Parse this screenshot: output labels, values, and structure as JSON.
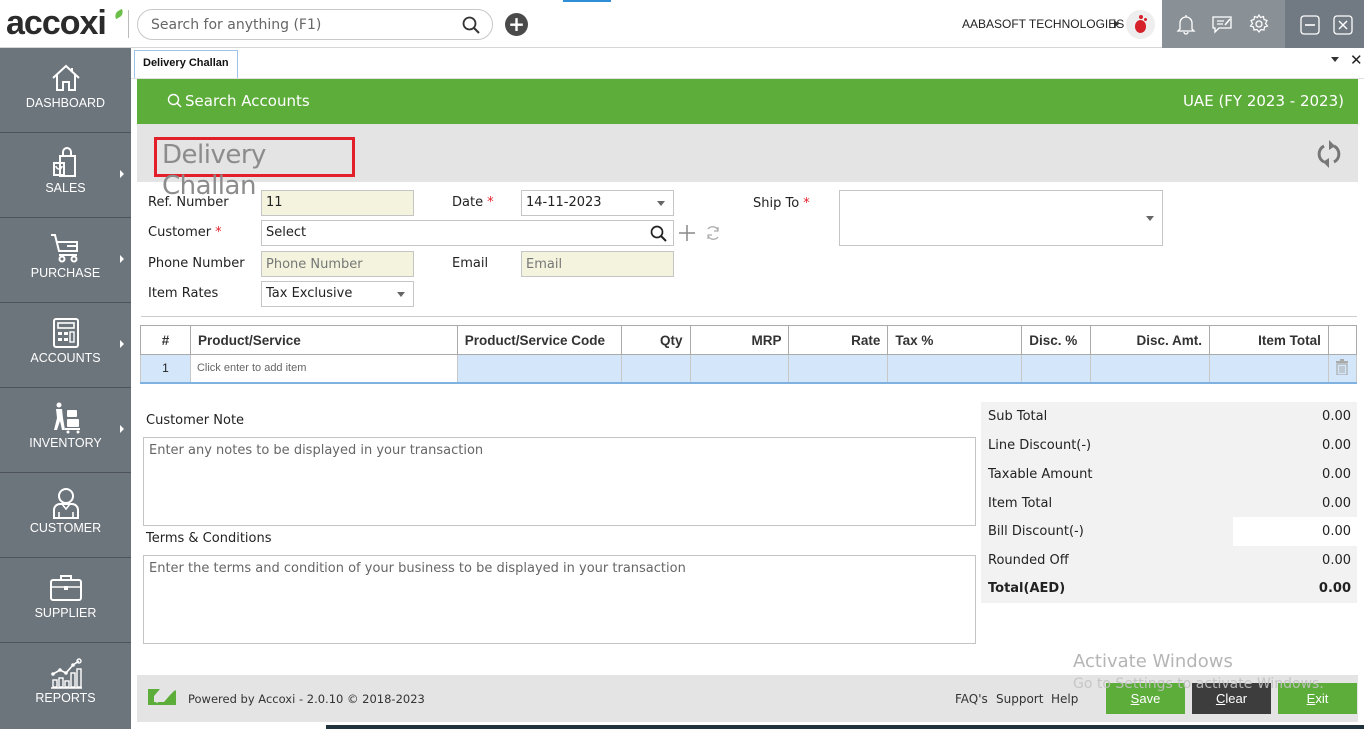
{
  "app": {
    "logo_text": "accoxi",
    "global_search_placeholder": "Search for anything (F1)",
    "company_name": "AABASOFT TECHNOLOGIES",
    "icons": [
      "search-icon",
      "add-icon",
      "bell-icon",
      "message-icon",
      "gear-icon",
      "minimize-icon",
      "close-icon"
    ]
  },
  "sidebar": {
    "items": [
      {
        "label": "DASHBOARD",
        "icon": "home-icon",
        "has_submenu": false
      },
      {
        "label": "SALES",
        "icon": "shopping-bag-icon",
        "has_submenu": true
      },
      {
        "label": "PURCHASE",
        "icon": "cart-icon",
        "has_submenu": true
      },
      {
        "label": "ACCOUNTS",
        "icon": "calculator-icon",
        "has_submenu": true
      },
      {
        "label": "INVENTORY",
        "icon": "trolley-icon",
        "has_submenu": true
      },
      {
        "label": "CUSTOMER",
        "icon": "person-icon",
        "has_submenu": false
      },
      {
        "label": "SUPPLIER",
        "icon": "briefcase-icon",
        "has_submenu": false
      },
      {
        "label": "REPORTS",
        "icon": "chart-icon",
        "has_submenu": false
      }
    ]
  },
  "tabs": [
    {
      "label": "Delivery Challan",
      "active": true
    }
  ],
  "header": {
    "search_accounts": "Search Accounts",
    "region_fy": "UAE (FY 2023 - 2023)",
    "page_title": "Delivery Challan"
  },
  "form": {
    "ref_number": {
      "label": "Ref. Number",
      "value": "11"
    },
    "date": {
      "label": "Date",
      "value": "14-11-2023",
      "required": true
    },
    "ship_to": {
      "label": "Ship To",
      "value": "",
      "required": true
    },
    "customer": {
      "label": "Customer",
      "value": "Select",
      "required": true
    },
    "phone": {
      "label": "Phone Number",
      "placeholder": "Phone Number"
    },
    "email": {
      "label": "Email",
      "placeholder": "Email"
    },
    "item_rates": {
      "label": "Item Rates",
      "value": "Tax Exclusive"
    }
  },
  "items_table": {
    "columns": [
      "#",
      "Product/Service",
      "Product/Service Code",
      "Qty",
      "MRP",
      "Rate",
      "Tax %",
      "Disc. %",
      "Disc. Amt.",
      "Item Total"
    ],
    "rows": [
      {
        "index": "1",
        "product": "Click enter to add item",
        "code": "",
        "qty": "",
        "mrp": "",
        "rate": "",
        "tax": "",
        "disc_pct": "",
        "disc_amt": "",
        "item_total": ""
      }
    ]
  },
  "notes": {
    "customer_note_label": "Customer Note",
    "customer_note_placeholder": "Enter any notes to be displayed in your transaction",
    "terms_label": "Terms & Conditions",
    "terms_placeholder": "Enter the terms and condition of your business to be displayed in your transaction"
  },
  "totals": [
    {
      "label": "Sub Total",
      "value": "0.00"
    },
    {
      "label": "Line Discount(-)",
      "value": "0.00"
    },
    {
      "label": "Taxable Amount",
      "value": "0.00"
    },
    {
      "label": "Item Total",
      "value": "0.00"
    },
    {
      "label": "Bill Discount(-)",
      "value": "0.00",
      "editable": true
    },
    {
      "label": "Rounded Off",
      "value": "0.00"
    },
    {
      "label": "Total(AED)",
      "value": "0.00",
      "bold": true
    }
  ],
  "footer": {
    "powered_by": "Powered by Accoxi - 2.0.10 © 2018-2023",
    "links": [
      "FAQ's",
      "Support",
      "Help"
    ],
    "buttons": {
      "save": {
        "accel": "S",
        "rest": "ave",
        "color": "#5dad3b"
      },
      "clear": {
        "accel": "C",
        "rest": "lear",
        "color": "#3d3d3d"
      },
      "exit": {
        "accel": "E",
        "rest": "xit",
        "color": "#5dad3b"
      }
    }
  },
  "watermark": {
    "line1": "Activate Windows",
    "line2": "Go to Settings to activate Windows."
  },
  "colors": {
    "brand_green": "#5dad3b",
    "sidebar": "#6d757c",
    "required": "#e3202a",
    "row_highlight": "#d3e6fa"
  }
}
